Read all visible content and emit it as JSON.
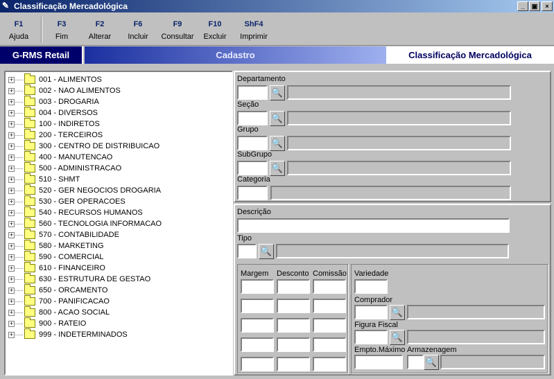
{
  "window": {
    "title": "Classificação Mercadológica",
    "icon": "edit-pencil-icon",
    "min": "_",
    "max": "▣",
    "close": "×"
  },
  "toolbar": [
    {
      "key": "F1",
      "label": "Ajuda"
    },
    {
      "key": "F3",
      "label": "Fim"
    },
    {
      "key": "F2",
      "label": "Alterar"
    },
    {
      "key": "F6",
      "label": "Incluir"
    },
    {
      "key": "F9",
      "label": "Consultar"
    },
    {
      "key": "F10",
      "label": "Excluir"
    },
    {
      "key": "ShF4",
      "label": "Imprimir"
    }
  ],
  "banner": {
    "app": "G-RMS Retail",
    "section": "Cadastro",
    "screen": "Classificação Mercadológica"
  },
  "tree": {
    "expander": "+",
    "items": [
      "001 - ALIMENTOS",
      "002 - NAO ALIMENTOS",
      "003 - DROGARIA",
      "004 - DIVERSOS",
      "100 - INDIRETOS",
      "200 - TERCEIROS",
      "300 - CENTRO DE DISTRIBUICAO",
      "400 - MANUTENCAO",
      "500 - ADMINISTRACAO",
      "510 - SHMT",
      "520 - GER NEGOCIOS DROGARIA",
      "530 - GER OPERACOES",
      "540 - RECURSOS HUMANOS",
      "560 - TECNOLOGIA INFORMACAO",
      "570 - CONTABILIDADE",
      "580 - MARKETING",
      "590 - COMERCIAL",
      "610 - FINANCEIRO",
      "630 - ESTRUTURA DE GESTAO",
      "650 - ORCAMENTO",
      "700 - PANIFICACAO",
      "800 - ACAO SOCIAL",
      "900 - RATEIO",
      "999 - INDETERMINADOS"
    ]
  },
  "form": {
    "departamento": "Departamento",
    "secao": "Seção",
    "grupo": "Grupo",
    "subgrupo": "SubGrupo",
    "categoria": "Categoria",
    "descricao": "Descrição",
    "tipo": "Tipo",
    "margem": "Margem",
    "desconto": "Desconto",
    "comissao": "Comissão",
    "variedade": "Variedade",
    "comprador": "Comprador",
    "figura_fiscal": "Figura Fiscal",
    "empto_maximo": "Empto.Máximo",
    "armazenagem": "Armazenagem",
    "lookup_icon": "binoculars-icon",
    "lookup_glyph": "🔍"
  }
}
